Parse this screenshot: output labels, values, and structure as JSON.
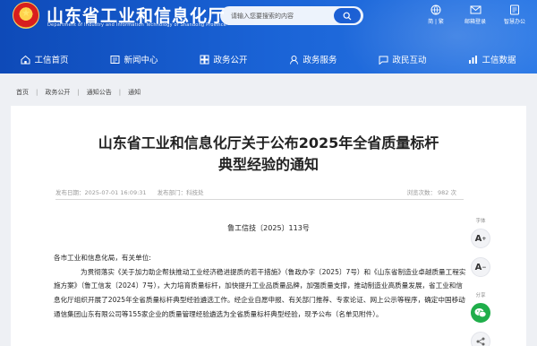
{
  "header": {
    "title": "山东省工业和信息化厅",
    "subtitle": "Department of Industry and Information Technology of Shandong Province",
    "search_placeholder": "请输入您要搜索的内容",
    "tools": [
      {
        "label": "简 | 繁",
        "icon": "language-icon"
      },
      {
        "label": "邮箱登录",
        "icon": "mail-icon"
      },
      {
        "label": "智慧办公",
        "icon": "office-icon"
      }
    ]
  },
  "nav": [
    {
      "label": "工信首页",
      "icon": "home-icon"
    },
    {
      "label": "新闻中心",
      "icon": "news-icon"
    },
    {
      "label": "政务公开",
      "icon": "open-gov-icon"
    },
    {
      "label": "政务服务",
      "icon": "service-icon"
    },
    {
      "label": "政民互动",
      "icon": "interaction-icon"
    },
    {
      "label": "工信数据",
      "icon": "data-icon"
    }
  ],
  "breadcrumb": [
    "首页",
    "政务公开",
    "通知公告",
    "通知"
  ],
  "article": {
    "title_line1": "山东省工业和信息化厅关于公布2025年全省质量标杆",
    "title_line2": "典型经验的通知",
    "publish_time": "发布日期：2025-07-01 16:09:31",
    "source": "发布部门：科技处",
    "views": "浏览次数：  982  次",
    "doc_number": "鲁工信技〔2025〕113号",
    "salutation": "各市工业和信息化局，有关单位:",
    "paragraph": "为贯彻落实《关于加力助企帮扶推动工业经济稳进提质的若干措施》（鲁政办字〔2025〕7号）和《山东省制造业卓越质量工程实施方案》（鲁工信发〔2024〕7号），大力培育质量标杆，加快提升工业品质量品牌，加强质量支撑，推动制造业高质量发展，省工业和信息化厅组织开展了2025年全省质量标杆典型经验遴选工作。经企业自愿申报、有关部门推荐、专家论证、网上公示等程序，确定中国移动通信集团山东有限公司等155家企业的质量管理经验遴选为全省质量标杆典型经验，现予公布（名单见附件）。"
  },
  "side": {
    "font_label": "字体",
    "increase": "A",
    "decrease": "A",
    "share_label": "分享"
  },
  "colors": {
    "header_blue": "#1a63d6",
    "wechat_green": "#1fae4a"
  }
}
